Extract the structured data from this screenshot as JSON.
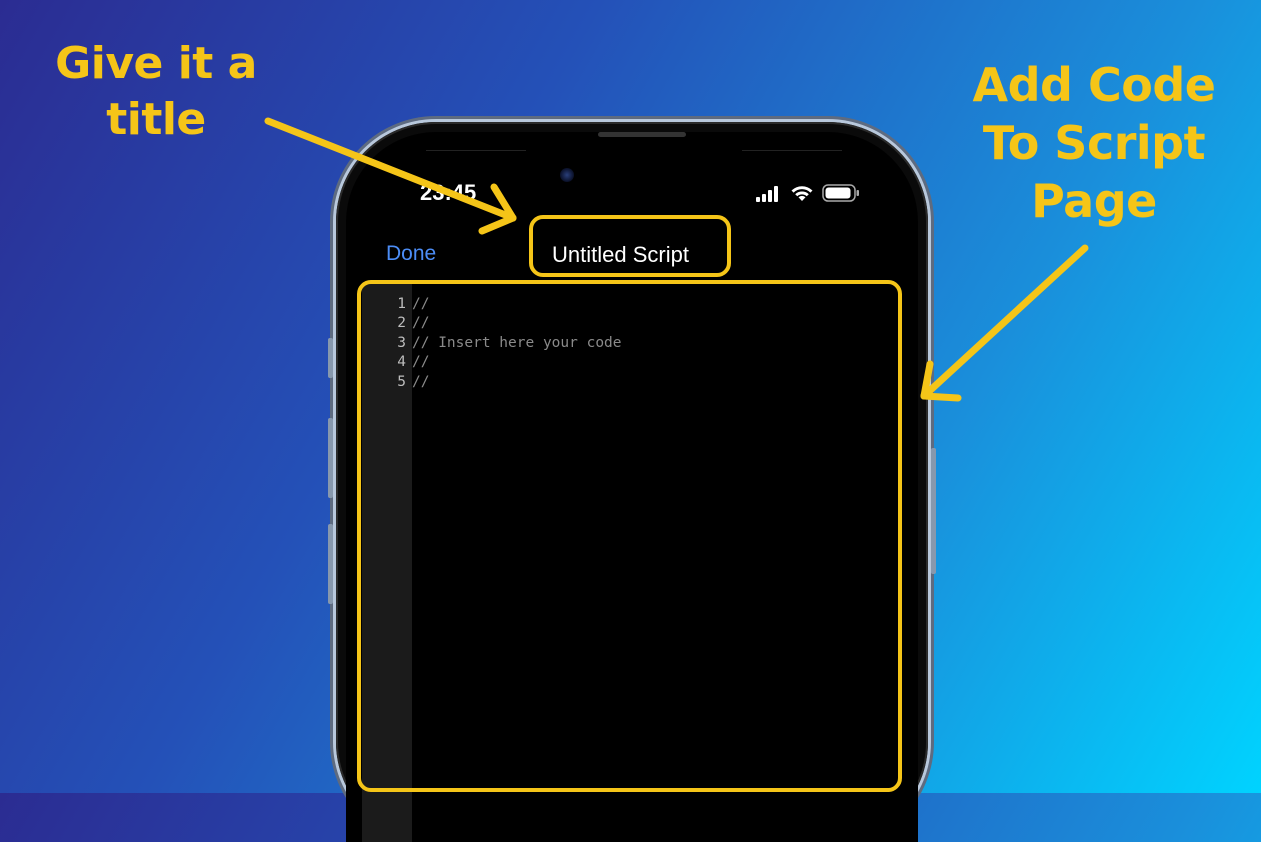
{
  "annotations": {
    "left_line1": "Give it a",
    "left_line2": "title",
    "right_line1": "Add Code",
    "right_line2": "To Script",
    "right_line3": "Page"
  },
  "status_bar": {
    "time": "23:45",
    "icons": [
      "signal-icon",
      "wifi-icon",
      "battery-icon"
    ]
  },
  "nav": {
    "done_label": "Done",
    "title": "Untitled Script"
  },
  "editor": {
    "lines": [
      {
        "number": "1",
        "text": "//"
      },
      {
        "number": "2",
        "text": "//"
      },
      {
        "number": "3",
        "text": "// Insert here your code"
      },
      {
        "number": "4",
        "text": "//"
      },
      {
        "number": "5",
        "text": "//"
      }
    ]
  },
  "colors": {
    "accent_annotation": "#f5c518",
    "done_blue": "#4c8df6"
  }
}
